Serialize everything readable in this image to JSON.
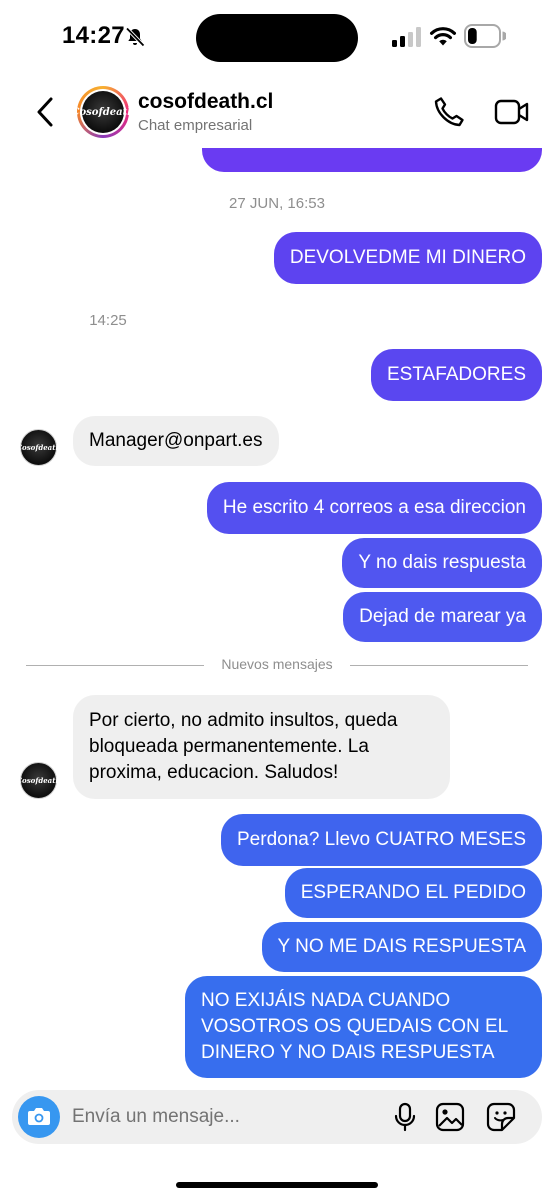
{
  "status_bar": {
    "time": "14:27",
    "battery_level": 0.3
  },
  "header": {
    "name": "cosofdeath.cl",
    "subtitle": "Chat empresarial",
    "avatar_text": "Cosofdeath"
  },
  "messages": [
    {
      "type": "out",
      "text": "",
      "color": "#6a3bf2"
    },
    {
      "type": "timestamp",
      "text": "27 JUN, 16:53"
    },
    {
      "type": "out",
      "text": "DEVOLVEDME MI DINERO",
      "color": "#5d43f0"
    },
    {
      "type": "timestamp",
      "text": "14:25"
    },
    {
      "type": "out",
      "text": "ESTAFADORES",
      "color": "#5a47f0"
    },
    {
      "type": "in",
      "text": "Manager@onpart.es"
    },
    {
      "type": "out",
      "text": "He escrito 4 correos a esa direccion",
      "color": "#5450f0"
    },
    {
      "type": "out",
      "text": "Y no dais respuesta",
      "color": "#5155f0"
    },
    {
      "type": "out",
      "text": "Dejad de marear ya",
      "color": "#4e59f0"
    },
    {
      "type": "divider",
      "text": "Nuevos mensajes"
    },
    {
      "type": "in",
      "text": "Por cierto, no admito insultos, queda bloqueada permanentemente. La proxima, educacion. Saludos!"
    },
    {
      "type": "out",
      "text": "Perdona? Llevo CUATRO MESES",
      "color": "#3f64ee"
    },
    {
      "type": "out",
      "text": "ESPERANDO EL PEDIDO",
      "color": "#3c67ee"
    },
    {
      "type": "out",
      "text": "Y NO ME DAIS RESPUESTA",
      "color": "#3a6aee"
    },
    {
      "type": "out",
      "text": "NO EXIJÁIS NADA CUANDO VOSOTROS OS QUEDAIS  CON EL DINERO Y NO DAIS RESPUESTA",
      "color": "#376eee"
    }
  ],
  "composer": {
    "placeholder": "Envía un mensaje..."
  },
  "icons": {
    "status": [
      "bell-slash-icon",
      "signal-icon",
      "wifi-icon",
      "battery-icon"
    ],
    "header": [
      "back-icon",
      "phone-icon",
      "video-icon"
    ],
    "composer": [
      "camera-icon",
      "mic-icon",
      "gallery-icon",
      "sticker-icon"
    ]
  }
}
